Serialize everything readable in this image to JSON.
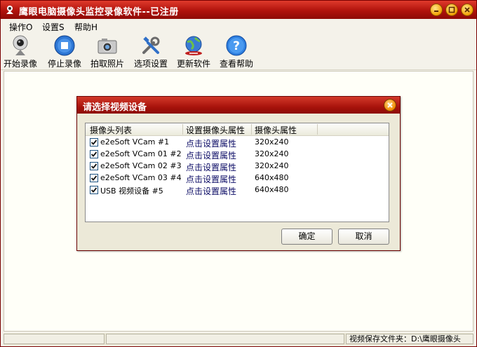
{
  "window": {
    "title": "鹰眼电脑摄像头监控录像软件--已注册",
    "accent_color": "#b0120c"
  },
  "menu": [
    {
      "label": "操作O"
    },
    {
      "label": "设置S"
    },
    {
      "label": "帮助H"
    }
  ],
  "toolbar": [
    {
      "label": "开始录像",
      "icon": "webcam-icon"
    },
    {
      "label": "停止录像",
      "icon": "stop-icon"
    },
    {
      "label": "拍取照片",
      "icon": "camera-icon"
    },
    {
      "label": "选项设置",
      "icon": "tools-icon"
    },
    {
      "label": "更新软件",
      "icon": "globe-update-icon"
    },
    {
      "label": "查看帮助",
      "icon": "help-icon"
    }
  ],
  "dialog": {
    "title": "请选择视频设备",
    "columns": [
      "摄像头列表",
      "设置摄像头属性",
      "摄像头属性"
    ],
    "devices": [
      {
        "name": "e2eSoft VCam #1",
        "link": "点击设置属性",
        "resolution": "320x240",
        "checked": true
      },
      {
        "name": "e2eSoft VCam 01 #2",
        "link": "点击设置属性",
        "resolution": "320x240",
        "checked": true
      },
      {
        "name": "e2eSoft VCam 02 #3",
        "link": "点击设置属性",
        "resolution": "320x240",
        "checked": true
      },
      {
        "name": "e2eSoft VCam 03 #4",
        "link": "点击设置属性",
        "resolution": "640x480",
        "checked": true
      },
      {
        "name": "USB 视频设备 #5",
        "link": "点击设置属性",
        "resolution": "640x480",
        "checked": true
      }
    ],
    "ok_label": "确定",
    "cancel_label": "取消"
  },
  "status": {
    "save_folder": "视频保存文件夹：D:\\鹰眼摄像头"
  }
}
